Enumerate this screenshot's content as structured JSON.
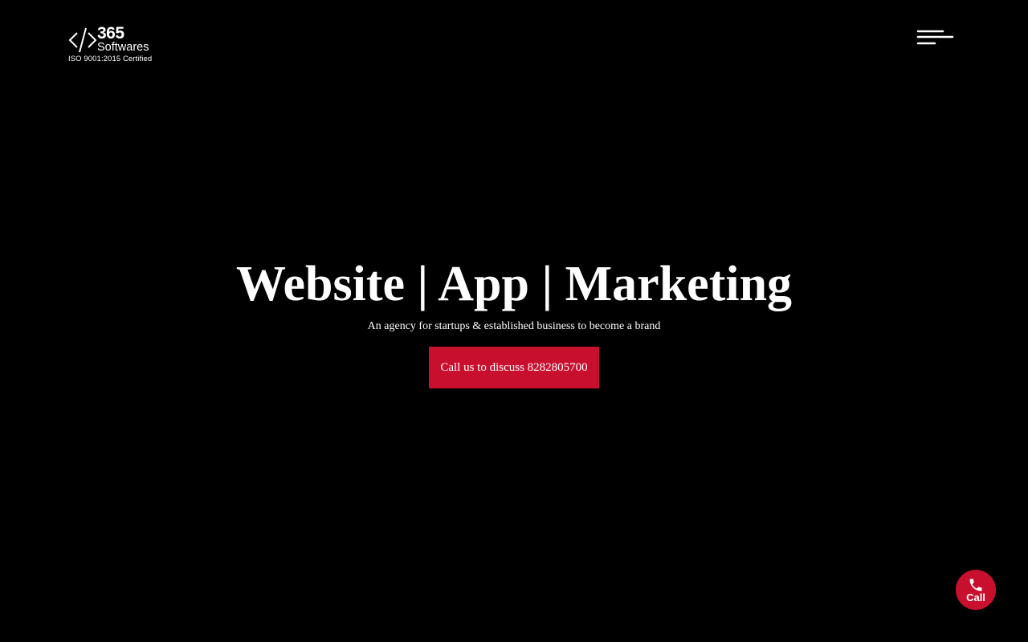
{
  "header": {
    "logo": {
      "number": "365",
      "word": "Softwares",
      "certification": "ISO 9001:2015 Certified"
    },
    "menu_icon": "hamburger-menu-icon"
  },
  "hero": {
    "title": "Website | App | Marketing",
    "subtitle": "An agency for startups & established business to become a brand",
    "cta_label": "Call us to discuss 8282805700"
  },
  "floating_call": {
    "label": "Call",
    "icon": "phone-icon"
  },
  "colors": {
    "background": "#000000",
    "text": "#ffffff",
    "accent": "#c8102e"
  }
}
